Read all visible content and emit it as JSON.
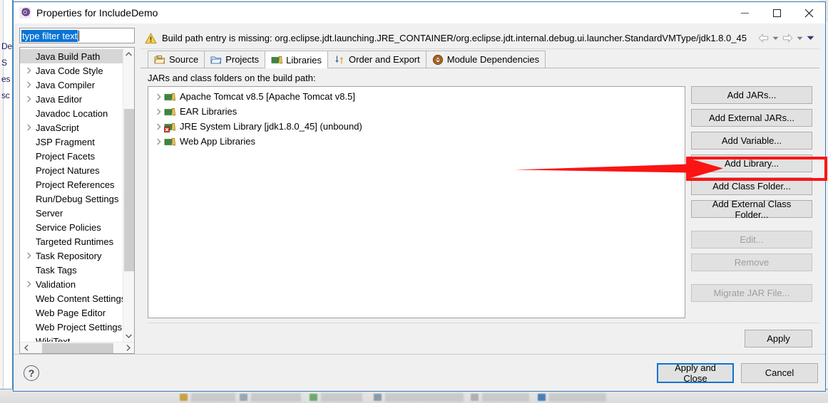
{
  "window": {
    "title": "Properties for IncludeDemo",
    "icon": "properties-gear-icon",
    "minimize_label": "Minimize",
    "maximize_label": "Maximize",
    "close_label": "Close"
  },
  "filter": {
    "value": "type filter text",
    "placeholder": "type filter text"
  },
  "sidebar": {
    "items": [
      {
        "label": "Java Build Path",
        "expandable": false,
        "selected": true
      },
      {
        "label": "Java Code Style",
        "expandable": true,
        "selected": false
      },
      {
        "label": "Java Compiler",
        "expandable": true,
        "selected": false
      },
      {
        "label": "Java Editor",
        "expandable": true,
        "selected": false
      },
      {
        "label": "Javadoc Location",
        "expandable": false,
        "selected": false
      },
      {
        "label": "JavaScript",
        "expandable": true,
        "selected": false
      },
      {
        "label": "JSP Fragment",
        "expandable": false,
        "selected": false
      },
      {
        "label": "Project Facets",
        "expandable": false,
        "selected": false
      },
      {
        "label": "Project Natures",
        "expandable": false,
        "selected": false
      },
      {
        "label": "Project References",
        "expandable": false,
        "selected": false
      },
      {
        "label": "Run/Debug Settings",
        "expandable": false,
        "selected": false
      },
      {
        "label": "Server",
        "expandable": false,
        "selected": false
      },
      {
        "label": "Service Policies",
        "expandable": false,
        "selected": false
      },
      {
        "label": "Targeted Runtimes",
        "expandable": false,
        "selected": false
      },
      {
        "label": "Task Repository",
        "expandable": true,
        "selected": false
      },
      {
        "label": "Task Tags",
        "expandable": false,
        "selected": false
      },
      {
        "label": "Validation",
        "expandable": true,
        "selected": false
      },
      {
        "label": "Web Content Settings",
        "expandable": false,
        "selected": false
      },
      {
        "label": "Web Page Editor",
        "expandable": false,
        "selected": false
      },
      {
        "label": "Web Project Settings",
        "expandable": false,
        "selected": false
      },
      {
        "label": "WikiText",
        "expandable": false,
        "selected": false
      }
    ]
  },
  "message_bar": {
    "icon": "warning-icon",
    "text": "Build path entry is missing: org.eclipse.jdt.launching.JRE_CONTAINER/org.eclipse.jdt.internal.debug.ui.launcher.StandardVMType/jdk1.8.0_45",
    "back_label": "Back",
    "back_menu_label": "Back history",
    "forward_label": "Forward",
    "forward_menu_label": "Forward history",
    "menu_label": "View menu"
  },
  "tabs": [
    {
      "label": "Source",
      "icon": "source-folder-icon",
      "active": false
    },
    {
      "label": "Projects",
      "icon": "projects-folder-icon",
      "active": false
    },
    {
      "label": "Libraries",
      "icon": "libraries-books-icon",
      "active": true
    },
    {
      "label": "Order and Export",
      "icon": "order-export-arrows-icon",
      "active": false
    },
    {
      "label": "Module Dependencies",
      "icon": "module-circle-icon",
      "active": false
    }
  ],
  "content": {
    "list_label": "JARs and class folders on the build path:",
    "libraries": [
      {
        "label": "Apache Tomcat v8.5 [Apache Tomcat v8.5]",
        "icon": "library-books-icon",
        "error": false
      },
      {
        "label": "EAR Libraries",
        "icon": "library-books-icon",
        "error": false
      },
      {
        "label": "JRE System Library [jdk1.8.0_45] (unbound)",
        "icon": "library-books-icon",
        "error": true
      },
      {
        "label": "Web App Libraries",
        "icon": "library-books-icon",
        "error": false
      }
    ],
    "buttons": [
      {
        "label": "Add JARs...",
        "enabled": true,
        "gap_after": "sm"
      },
      {
        "label": "Add External JARs...",
        "enabled": true,
        "gap_after": "sm"
      },
      {
        "label": "Add Variable...",
        "enabled": true,
        "gap_after": "sm"
      },
      {
        "label": "Add Library...",
        "enabled": true,
        "gap_after": "sm",
        "highlighted": true
      },
      {
        "label": "Add Class Folder...",
        "enabled": true,
        "gap_after": "sm"
      },
      {
        "label": "Add External Class Folder...",
        "enabled": true,
        "gap_after": "lg"
      },
      {
        "label": "Edit...",
        "enabled": false,
        "gap_after": "sm"
      },
      {
        "label": "Remove",
        "enabled": false,
        "gap_after": "lg"
      },
      {
        "label": "Migrate JAR File...",
        "enabled": false,
        "gap_after": "sm"
      }
    ],
    "apply_label": "Apply"
  },
  "footer": {
    "help_label": "?",
    "apply_and_close_label": "Apply and Close",
    "cancel_label": "Cancel"
  },
  "background": {
    "side_fragments": [
      "De",
      "S",
      "es",
      "sc"
    ]
  },
  "annotation": {
    "highlight_target": "Add Library...",
    "accent_color": "#fb1414"
  }
}
